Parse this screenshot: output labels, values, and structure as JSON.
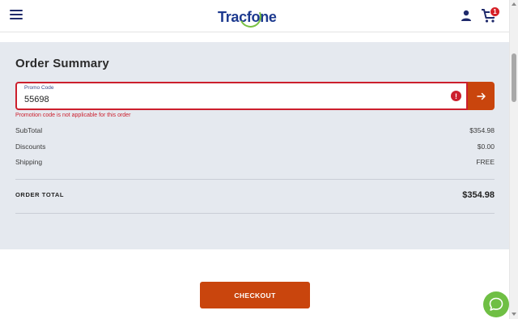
{
  "header": {
    "logo_text": "Tracfone",
    "cart_count": "1",
    "icons": {
      "menu": "hamburger-menu-icon",
      "user": "user-icon",
      "cart": "cart-icon"
    }
  },
  "summary": {
    "title": "Order Summary",
    "promo": {
      "label": "Promo Code",
      "value": "55698",
      "error": "Promotion code is not applicable for this order"
    },
    "rows": [
      {
        "label": "SubTotal",
        "value": "$354.98"
      },
      {
        "label": "Discounts",
        "value": "$0.00"
      },
      {
        "label": "Shipping",
        "value": "FREE"
      }
    ],
    "total_label": "ORDER TOTAL",
    "total_value": "$354.98"
  },
  "checkout": {
    "label": "CHECKOUT"
  },
  "colors": {
    "brand_blue": "#1d3a8f",
    "accent_orange": "#c9450d",
    "error_red": "#cc1f2d",
    "chat_green": "#6fbf44",
    "panel_bg": "#e5e9ef"
  }
}
